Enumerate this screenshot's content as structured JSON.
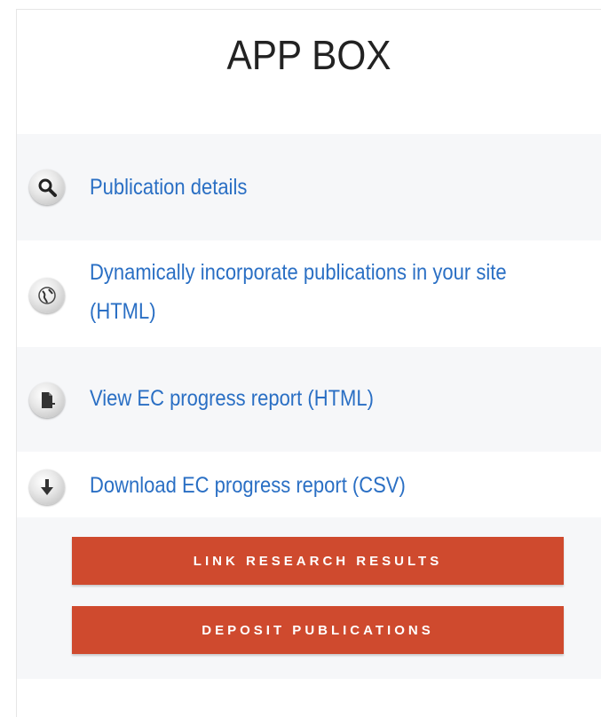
{
  "app_box": {
    "title": "APP BOX",
    "items": [
      {
        "label": "Publication details",
        "icon": "magnifier-icon"
      },
      {
        "label": "Dynamically incorporate publications in your site (HTML)",
        "icon": "globe-icon"
      },
      {
        "label": "View EC progress report (HTML)",
        "icon": "document-icon"
      },
      {
        "label": "Download EC progress report (CSV)",
        "icon": "download-arrow-icon"
      }
    ],
    "buttons": {
      "link_research_results": "LINK RESEARCH RESULTS",
      "deposit_publications": "DEPOSIT PUBLICATIONS"
    }
  },
  "colors": {
    "link": "#2a6fc4",
    "button": "#cf4a2e",
    "row_alt": "#f6f7f9"
  }
}
